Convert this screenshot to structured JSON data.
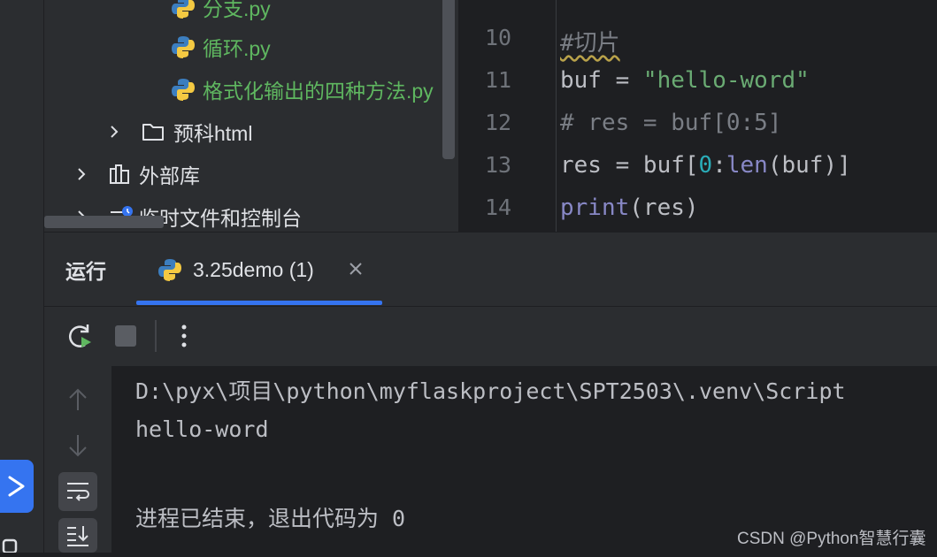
{
  "project_tree": {
    "items": [
      {
        "label": "分支.py",
        "kind": "python-file"
      },
      {
        "label": "循环.py",
        "kind": "python-file"
      },
      {
        "label": "格式化输出的四种方法.py",
        "kind": "python-file"
      },
      {
        "label": "预科html",
        "kind": "folder"
      },
      {
        "label": "外部库",
        "kind": "library"
      },
      {
        "label": "临时文件和控制台",
        "kind": "scratches"
      }
    ]
  },
  "editor": {
    "line_numbers": [
      "10",
      "11",
      "12",
      "13",
      "14"
    ],
    "lines": [
      {
        "comment": "#切片"
      },
      {
        "var": "buf = ",
        "string": "\"hello-word\""
      },
      {
        "comment": "# res = buf[0:5]"
      },
      {
        "var": "res = buf[",
        "num": "0",
        "colon": ":",
        "builtin": "len",
        "rest": "(buf)]"
      },
      {
        "builtin": "print",
        "rest": "(res)"
      }
    ]
  },
  "tool_window": {
    "title": "运行",
    "tab_label": "3.25demo (1)"
  },
  "console": {
    "lines": [
      "D:\\pyx\\项目\\python\\myflaskproject\\SPT2503\\.venv\\Script",
      "hello-word",
      "",
      "进程已结束，退出代码为 0"
    ]
  },
  "watermark": "CSDN @Python智慧行囊",
  "colors": {
    "accent": "#3574f0",
    "python_file_green": "#5fb760",
    "string_green": "#6aab73",
    "number_cyan": "#2aacb8",
    "builtin_purple": "#8888c6",
    "comment_gray": "#7a7e85"
  }
}
